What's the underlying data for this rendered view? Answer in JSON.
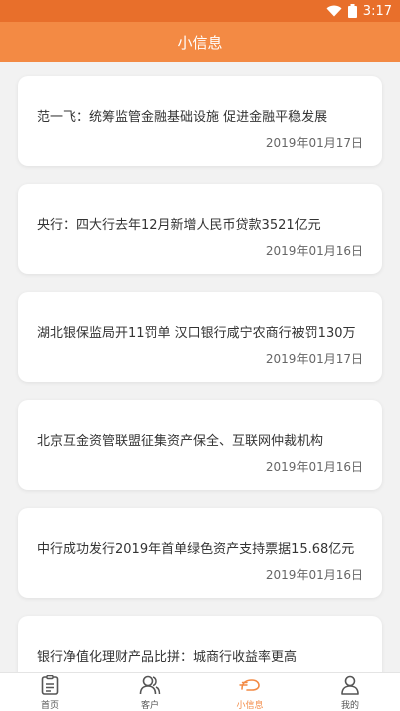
{
  "status_bar": {
    "time": "3:17"
  },
  "header": {
    "title": "小信息"
  },
  "news": [
    {
      "title": "范一飞：统筹监管金融基础设施 促进金融平稳发展",
      "date": "2019年01月17日"
    },
    {
      "title": "央行：四大行去年12月新增人民币贷款3521亿元",
      "date": "2019年01月16日"
    },
    {
      "title": "湖北银保监局开11罚单 汉口银行咸宁农商行被罚130万",
      "date": "2019年01月17日"
    },
    {
      "title": "北京互金资管联盟征集资产保全、互联网仲裁机构",
      "date": "2019年01月16日"
    },
    {
      "title": "中行成功发行2019年首单绿色资产支持票据15.68亿元",
      "date": "2019年01月16日"
    },
    {
      "title": "银行净值化理财产品比拼：城商行收益率更高",
      "date": ""
    }
  ],
  "tabs": [
    {
      "label": "首页",
      "icon": "document-icon"
    },
    {
      "label": "客户",
      "icon": "users-icon"
    },
    {
      "label": "小信息",
      "icon": "message-icon",
      "active": true
    },
    {
      "label": "我的",
      "icon": "user-icon"
    }
  ],
  "colors": {
    "accent": "#f38a44",
    "status_bar": "#e86f2b"
  }
}
